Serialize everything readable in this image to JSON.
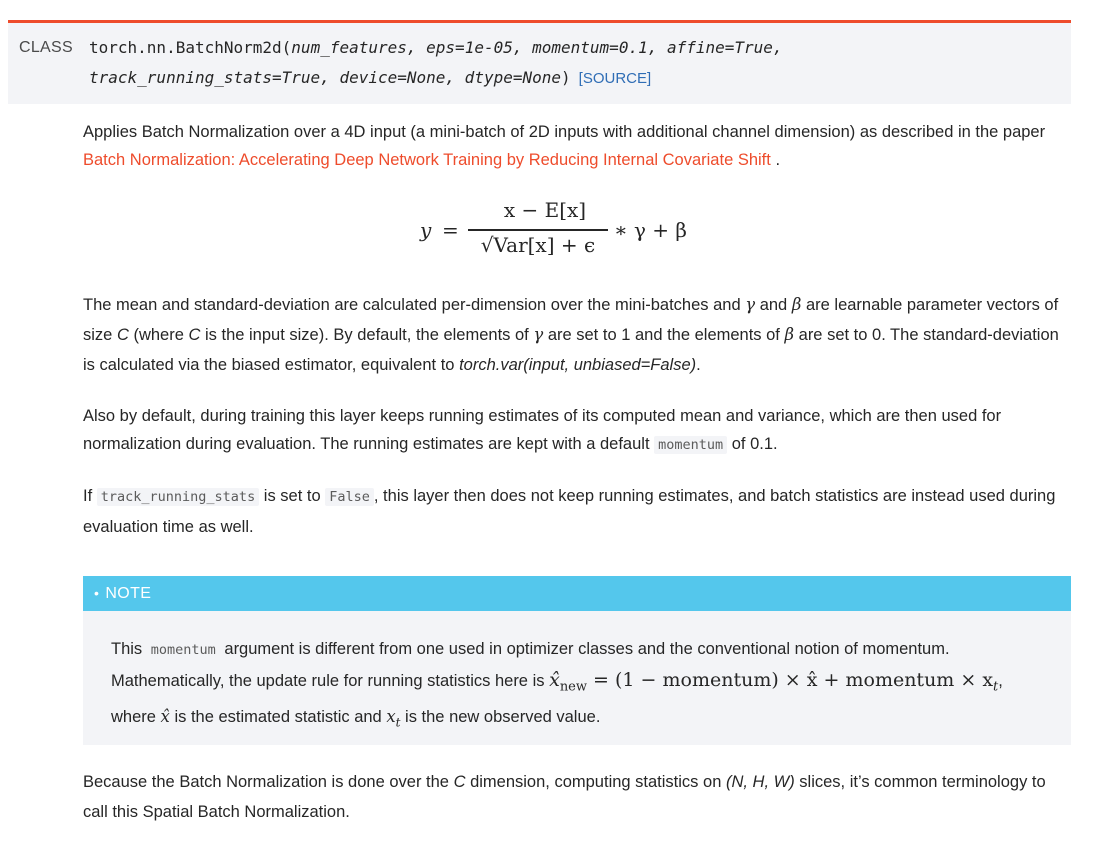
{
  "signature": {
    "keyword": "CLASS",
    "name": "torch.nn.BatchNorm2d",
    "params_line1": "num_features, eps=1e-05, momentum=0.1, affine=True,",
    "params_line2": "track_running_stats=True, device=None, dtype=None",
    "source_link": "[SOURCE]"
  },
  "intro": {
    "text": "Applies Batch Normalization over a 4D input (a mini-batch of 2D inputs with additional channel dimension) as described in the paper",
    "link": "Batch Normalization: Accelerating Deep Network Training by Reducing Internal Covariate Shift",
    "end": "."
  },
  "equation": {
    "lhs": "y",
    "equals": "=",
    "numerator": "x − E[x]",
    "denominator": "√Var[x] + ϵ",
    "rest": "∗ γ + β"
  },
  "para_mean": {
    "t1": "The mean and standard-deviation are calculated per-dimension over the mini-batches and",
    "gamma": "γ",
    "t2": "and",
    "beta": "β",
    "t3": "are learnable parameter vectors of size",
    "c1": "C",
    "t4": "(where",
    "c2": "C",
    "t5": "is the input size). By default, the elements of",
    "gamma2": "γ",
    "t6": "are set to 1 and the elements of",
    "beta2": "β",
    "t7": "are set to 0. The standard-deviation is calculated via the biased estimator, equivalent to",
    "fn": "torch.var(input, unbiased=False)",
    "t8": "."
  },
  "para_running": {
    "t1": "Also by default, during training this layer keeps running estimates of its computed mean and variance, which are then used for normalization during evaluation. The running estimates are kept with a default",
    "code": "momentum",
    "t2": "of 0.1."
  },
  "para_track": {
    "t1": "If",
    "code1": "track_running_stats",
    "t2": "is set to",
    "code2": "False",
    "t3": ", this layer then does not keep running estimates, and batch statistics are instead used during evaluation time as well."
  },
  "note": {
    "bullet": "•",
    "title": "NOTE",
    "t1": "This",
    "code": "momentum",
    "t2": "argument is different from one used in optimizer classes and the conventional notion of momentum. Mathematically, the update rule for running statistics here is",
    "formula1": "x̂",
    "formula_sub": "new",
    "formula2": " = (1 − momentum) × x̂ + momentum × x",
    "formula_sub2": "t",
    "t3": ", where",
    "xhat": "x̂",
    "t4": "is the estimated statistic and",
    "xt": "x",
    "xt_sub": "t",
    "t5": "is the new observed value."
  },
  "para_spatial": {
    "t1": "Because the Batch Normalization is done over the",
    "c": "C",
    "t2": "dimension, computing statistics on",
    "nhw": "(N, H, W)",
    "t3": "slices, it’s common terminology to call this Spatial Batch Normalization."
  }
}
